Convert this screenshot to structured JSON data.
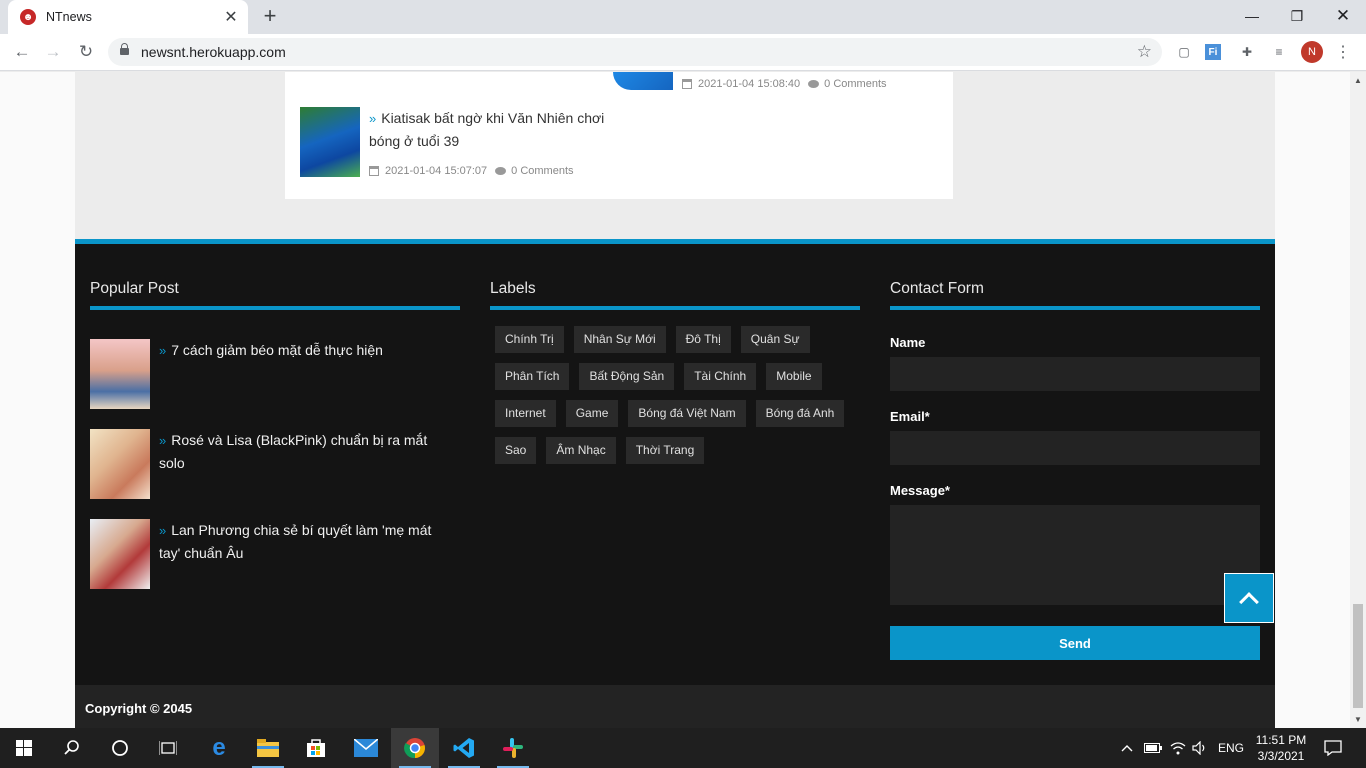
{
  "browser": {
    "tab_title": "NTnews",
    "tab_favicon": "ghost-icon",
    "url": "newsnt.herokuapp.com",
    "profile_initial": "N",
    "extensions": [
      "extension-doc-icon",
      "extension-fi-icon",
      "puzzle-icon",
      "media-icon"
    ]
  },
  "posts": [
    {
      "date": "2021-01-04 15:08:40",
      "comments": "0 Comments"
    },
    {
      "title": "Kiatisak bất ngờ khi Văn Nhiên chơi bóng ở tuổi 39",
      "date": "2021-01-04 15:07:07",
      "comments": "0 Comments"
    }
  ],
  "footer": {
    "popular": {
      "title": "Popular Post",
      "items": [
        {
          "title": "7 cách giảm béo mặt dễ thực hiện"
        },
        {
          "title": "Rosé và Lisa (BlackPink) chuẩn bị ra mắt solo"
        },
        {
          "title": "Lan Phương chia sẻ bí quyết làm 'mẹ mát tay' chuẩn Âu"
        }
      ]
    },
    "labels": {
      "title": "Labels",
      "items": [
        "Chính Trị",
        "Nhân Sự Mới",
        "Đô Thị",
        "Quân Sự",
        "Phân Tích",
        "Bất Động Sản",
        "Tài Chính",
        "Mobile",
        "Internet",
        "Game",
        "Bóng đá Việt Nam",
        "Bóng đá Anh",
        "Sao",
        "Âm Nhạc",
        "Thời Trang"
      ]
    },
    "contact": {
      "title": "Contact Form",
      "name_label": "Name",
      "email_label": "Email*",
      "message_label": "Message*",
      "send_label": "Send"
    },
    "copyright": "Copyright © 2045"
  },
  "taskbar": {
    "language": "ENG",
    "time": "11:51 PM",
    "date": "3/3/2021"
  },
  "colors": {
    "accent": "#0a95c9",
    "footer_bg": "#141414"
  }
}
